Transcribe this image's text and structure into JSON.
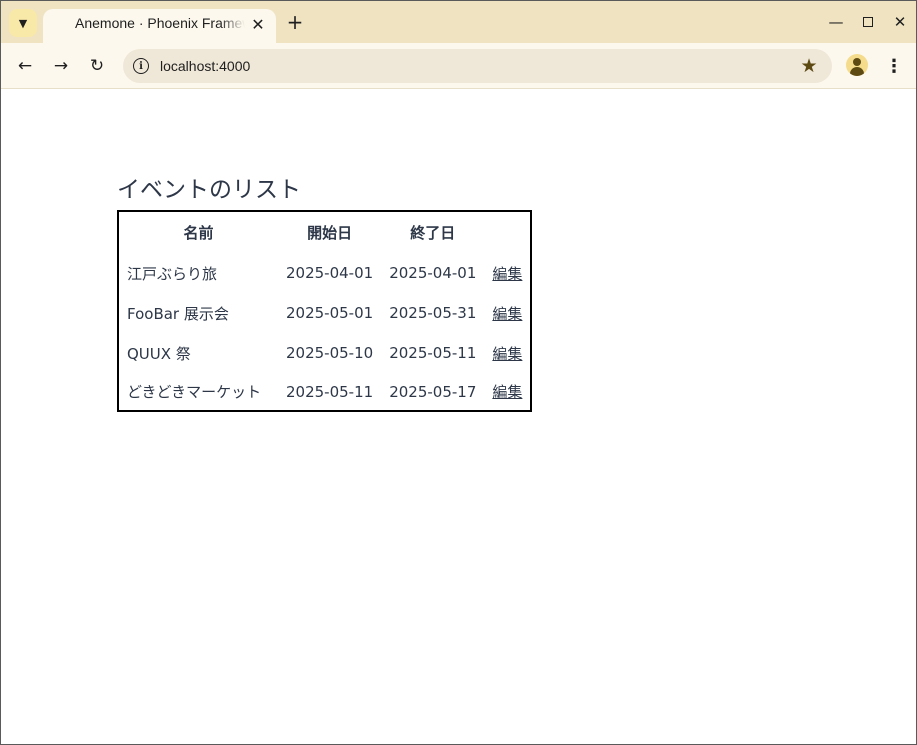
{
  "browser": {
    "tab_title": "Anemone · Phoenix Framework",
    "url": "localhost:4000",
    "new_tab_label": "+",
    "tab_close_label": "✕"
  },
  "page": {
    "title": "イベントのリスト",
    "table": {
      "headers": [
        "名前",
        "開始日",
        "終了日",
        ""
      ],
      "rows": [
        {
          "name": "江戸ぶらり旅",
          "start": "2025-04-01",
          "end": "2025-04-01",
          "action": "編集"
        },
        {
          "name": "FooBar 展示会",
          "start": "2025-05-01",
          "end": "2025-05-31",
          "action": "編集"
        },
        {
          "name": "QUUX 祭",
          "start": "2025-05-10",
          "end": "2025-05-11",
          "action": "編集"
        },
        {
          "name": "どきどきマーケット",
          "start": "2025-05-11",
          "end": "2025-05-17",
          "action": "編集"
        }
      ]
    }
  },
  "colors": {
    "tabstrip_bg": "#efe3c2",
    "toolbar_bg": "#fdf8ee",
    "text": "#2d3748",
    "table_border": "#000000"
  },
  "icons": [
    "tab-search-icon",
    "back-arrow-icon",
    "forward-arrow-icon",
    "reload-icon",
    "info-icon",
    "star-icon",
    "profile-icon",
    "menu-icon",
    "minimize-icon",
    "maximize-icon",
    "close-icon"
  ]
}
